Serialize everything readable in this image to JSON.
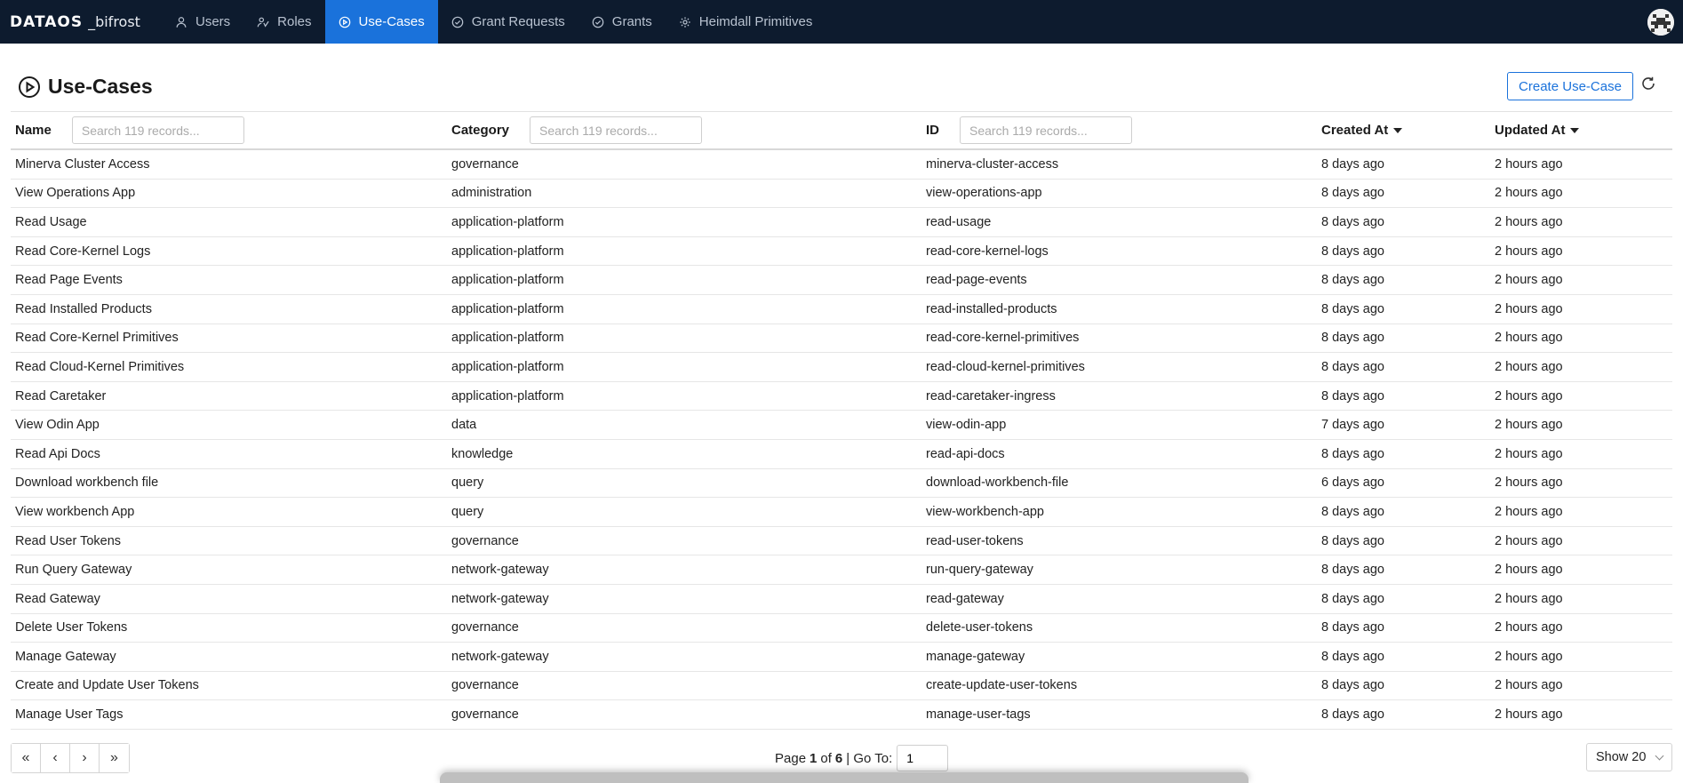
{
  "app": {
    "logo_main": "DATAOS",
    "logo_sub": "_bifrost"
  },
  "nav": [
    {
      "label": "Users",
      "icon": "user-icon",
      "active": false
    },
    {
      "label": "Roles",
      "icon": "roles-icon",
      "active": false
    },
    {
      "label": "Use-Cases",
      "icon": "play-circle-icon",
      "active": true
    },
    {
      "label": "Grant Requests",
      "icon": "check-circle-icon",
      "active": false
    },
    {
      "label": "Grants",
      "icon": "check-circle-icon",
      "active": false
    },
    {
      "label": "Heimdall Primitives",
      "icon": "gear-icon",
      "active": false
    }
  ],
  "page": {
    "title": "Use-Cases",
    "create_label": "Create Use-Case"
  },
  "columns": {
    "name": "Name",
    "category": "Category",
    "id": "ID",
    "created": "Created At",
    "updated": "Updated At",
    "search_placeholder": "Search 119 records..."
  },
  "rows": [
    [
      "Minerva Cluster Access",
      "governance",
      "minerva-cluster-access",
      "8 days ago",
      "2 hours ago"
    ],
    [
      "View Operations App",
      "administration",
      "view-operations-app",
      "8 days ago",
      "2 hours ago"
    ],
    [
      "Read Usage",
      "application-platform",
      "read-usage",
      "8 days ago",
      "2 hours ago"
    ],
    [
      "Read Core-Kernel Logs",
      "application-platform",
      "read-core-kernel-logs",
      "8 days ago",
      "2 hours ago"
    ],
    [
      "Read Page Events",
      "application-platform",
      "read-page-events",
      "8 days ago",
      "2 hours ago"
    ],
    [
      "Read Installed Products",
      "application-platform",
      "read-installed-products",
      "8 days ago",
      "2 hours ago"
    ],
    [
      "Read Core-Kernel Primitives",
      "application-platform",
      "read-core-kernel-primitives",
      "8 days ago",
      "2 hours ago"
    ],
    [
      "Read Cloud-Kernel Primitives",
      "application-platform",
      "read-cloud-kernel-primitives",
      "8 days ago",
      "2 hours ago"
    ],
    [
      "Read Caretaker",
      "application-platform",
      "read-caretaker-ingress",
      "8 days ago",
      "2 hours ago"
    ],
    [
      "View Odin App",
      "data",
      "view-odin-app",
      "7 days ago",
      "2 hours ago"
    ],
    [
      "Read Api Docs",
      "knowledge",
      "read-api-docs",
      "8 days ago",
      "2 hours ago"
    ],
    [
      "Download workbench file",
      "query",
      "download-workbench-file",
      "6 days ago",
      "2 hours ago"
    ],
    [
      "View workbench App",
      "query",
      "view-workbench-app",
      "8 days ago",
      "2 hours ago"
    ],
    [
      "Read User Tokens",
      "governance",
      "read-user-tokens",
      "8 days ago",
      "2 hours ago"
    ],
    [
      "Run Query Gateway",
      "network-gateway",
      "run-query-gateway",
      "8 days ago",
      "2 hours ago"
    ],
    [
      "Read Gateway",
      "network-gateway",
      "read-gateway",
      "8 days ago",
      "2 hours ago"
    ],
    [
      "Delete User Tokens",
      "governance",
      "delete-user-tokens",
      "8 days ago",
      "2 hours ago"
    ],
    [
      "Manage Gateway",
      "network-gateway",
      "manage-gateway",
      "8 days ago",
      "2 hours ago"
    ],
    [
      "Create and Update User Tokens",
      "governance",
      "create-update-user-tokens",
      "8 days ago",
      "2 hours ago"
    ],
    [
      "Manage User Tags",
      "governance",
      "manage-user-tags",
      "8 days ago",
      "2 hours ago"
    ]
  ],
  "pagination": {
    "page_label": "Page",
    "current": "1",
    "of_label": "of",
    "total": "6",
    "goto_label": "| Go To:",
    "goto_value": "1",
    "show_label": "Show 20",
    "first": "«",
    "prev": "‹",
    "next": "›",
    "last": "»"
  },
  "colors": {
    "topbar": "#0d1b2e",
    "accent": "#1a72db"
  }
}
